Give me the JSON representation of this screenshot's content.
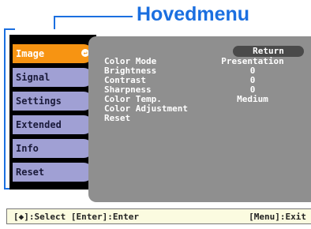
{
  "heading": "Hovedmenu",
  "menu": {
    "items": [
      {
        "label": "Image",
        "active": true
      },
      {
        "label": "Signal",
        "active": false
      },
      {
        "label": "Settings",
        "active": false
      },
      {
        "label": "Extended",
        "active": false
      },
      {
        "label": "Info",
        "active": false
      },
      {
        "label": "Reset",
        "active": false
      }
    ],
    "enter_icon": "enter-arrow-icon"
  },
  "panel": {
    "return_label": "Return",
    "rows": [
      {
        "label": "Color Mode",
        "value": "Presentation"
      },
      {
        "label": "Brightness",
        "value": "0"
      },
      {
        "label": "Contrast",
        "value": "0"
      },
      {
        "label": "Sharpness",
        "value": "0"
      },
      {
        "label": "Color Temp.",
        "value": "Medium"
      },
      {
        "label": "Color Adjustment",
        "value": ""
      },
      {
        "label": "Reset",
        "value": ""
      }
    ]
  },
  "status": {
    "left": "[◆]:Select [Enter]:Enter",
    "right": "[Menu]:Exit"
  },
  "colors": {
    "accent": "#1b6fe0",
    "active_item": "#f79412",
    "menu_item": "#a0a0d4",
    "panel": "#8f8f8f"
  }
}
